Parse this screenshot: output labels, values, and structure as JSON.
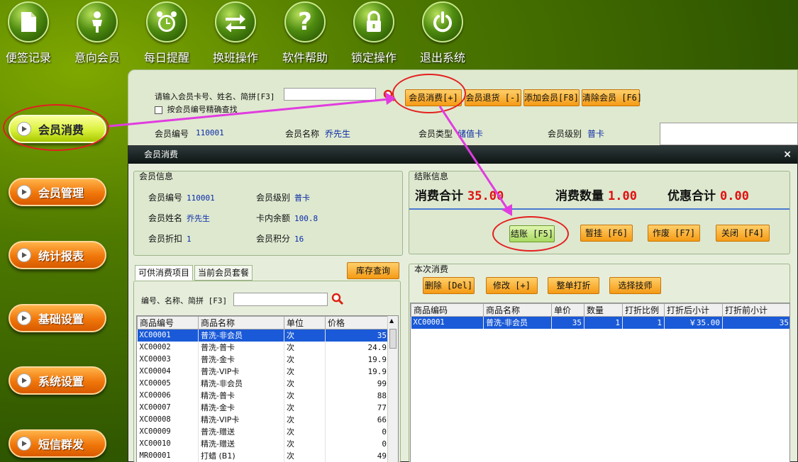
{
  "toolbar": [
    {
      "label": "便签记录",
      "icon": "document-icon"
    },
    {
      "label": "意向会员",
      "icon": "person-icon"
    },
    {
      "label": "每日提醒",
      "icon": "alarm-clock-icon"
    },
    {
      "label": "换班操作",
      "icon": "swap-arrows-icon"
    },
    {
      "label": "软件帮助",
      "icon": "question-icon"
    },
    {
      "label": "锁定操作",
      "icon": "lock-icon"
    },
    {
      "label": "退出系统",
      "icon": "power-icon"
    }
  ],
  "sidebar": [
    {
      "label": "会员消费",
      "active": true
    },
    {
      "label": "会员管理"
    },
    {
      "label": "统计报表"
    },
    {
      "label": "基础设置"
    },
    {
      "label": "系统设置"
    },
    {
      "label": "短信群发"
    }
  ],
  "search": {
    "label": "请输入会员卡号、姓名、简拼[F3]",
    "value": "",
    "exact_label": "按会员编号精确查找"
  },
  "top_buttons": {
    "consume": "会员消费[+]",
    "return": "会员退货 [-]",
    "add": "添加会员[F8]",
    "clear": "清除会员 [F6]"
  },
  "member_bar": {
    "no_label": "会员编号",
    "no": "110001",
    "name_label": "会员名称",
    "name": "乔先生",
    "type_label": "会员类型",
    "type": "储值卡",
    "level_label": "会员级别",
    "level": "普卡"
  },
  "dialog": {
    "title": "会员消费",
    "close": "×",
    "member_info": {
      "title": "会员信息",
      "no_label": "会员编号",
      "no": "110001",
      "level_label": "会员级别",
      "level": "普卡",
      "name_label": "会员姓名",
      "name": "乔先生",
      "balance_label": "卡内余额",
      "balance": "100.8",
      "discount_label": "会员折扣",
      "discount": "1",
      "points_label": "会员积分",
      "points": "16"
    },
    "checkout": {
      "title": "结账信息",
      "total_label": "消费合计",
      "total": "35.00",
      "qty_label": "消费数量",
      "qty": "1.00",
      "discount_label": "优惠合计",
      "discount": "0.00",
      "btn_checkout": "结账 [F5]",
      "btn_hold": "暂挂 [F6]",
      "btn_void": "作废 [F7]",
      "btn_close": "关闭 [F4]"
    },
    "tabs": [
      "可供消费项目",
      "当前会员套餐"
    ],
    "stock_button": "库存查询",
    "item_search": {
      "label": "编号、名称、简拼 [F3]",
      "value": ""
    },
    "items": {
      "columns": [
        "商品编号",
        "商品名称",
        "单位",
        "价格"
      ],
      "rows": [
        [
          "XC00001",
          "普洗-非会员",
          "次",
          "35"
        ],
        [
          "XC00002",
          "普洗-普卡",
          "次",
          "24.9"
        ],
        [
          "XC00003",
          "普洗-金卡",
          "次",
          "19.9"
        ],
        [
          "XC00004",
          "普洗-VIP卡",
          "次",
          "19.9"
        ],
        [
          "XC00005",
          "精洗-非会员",
          "次",
          "99"
        ],
        [
          "XC00006",
          "精洗-普卡",
          "次",
          "88"
        ],
        [
          "XC00007",
          "精洗-金卡",
          "次",
          "77"
        ],
        [
          "XC00008",
          "精洗-VIP卡",
          "次",
          "66"
        ],
        [
          "XC00009",
          "普洗-赠送",
          "次",
          "0"
        ],
        [
          "XC00010",
          "精洗-赠送",
          "次",
          "0"
        ],
        [
          "MR00001",
          "打蜡 (B1)",
          "次",
          "49"
        ]
      ]
    },
    "current": {
      "title": "本次消费",
      "btn_delete": "删除 [Del]",
      "btn_edit": "修改 [+]",
      "btn_whole_discount": "整单打折",
      "btn_tech": "选择技师",
      "columns": [
        "商品编码",
        "商品名称",
        "单价",
        "数量",
        "打折比例",
        "打折后小计",
        "打折前小计"
      ],
      "rows": [
        [
          "XC00001",
          "普洗-非会员",
          "35",
          "1",
          "1",
          "￥35.00",
          "35"
        ]
      ]
    }
  }
}
